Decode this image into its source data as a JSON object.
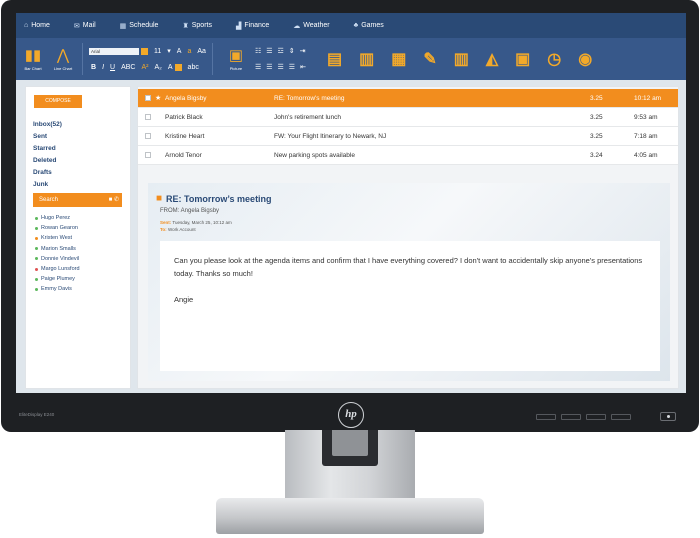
{
  "bezel": {
    "model": "EliteDisplay E240",
    "brand": "hp"
  },
  "nav": {
    "items": [
      {
        "label": "Home",
        "icon": "home-icon",
        "glyph": "⌂"
      },
      {
        "label": "Mail",
        "icon": "mail-icon",
        "glyph": "✉"
      },
      {
        "label": "Schedule",
        "icon": "calendar-icon",
        "glyph": "▦"
      },
      {
        "label": "Sports",
        "icon": "trophy-icon",
        "glyph": "♜"
      },
      {
        "label": "Finance",
        "icon": "finance-icon",
        "glyph": "▟"
      },
      {
        "label": "Weather",
        "icon": "cloud-icon",
        "glyph": "☁"
      },
      {
        "label": "Games",
        "icon": "games-icon",
        "glyph": "♣"
      }
    ]
  },
  "ribbon": {
    "bar_chart_label": "Bar Chart",
    "line_chart_label": "Line Chart",
    "font_name": "Arial",
    "font_size": "11",
    "picture_label": "Picture",
    "accent_color": "#f2a92a"
  },
  "sidebar": {
    "compose_label": "COMPOSE",
    "folders": [
      "Inbox(52)",
      "Sent",
      "Starred",
      "Deleted",
      "Drafts",
      "Junk"
    ],
    "search_label": "Search",
    "contacts": [
      {
        "name": "Hugo Perez",
        "status": "#5cb85c"
      },
      {
        "name": "Rowan Gearon",
        "status": "#5cb85c"
      },
      {
        "name": "Kristen West",
        "status": "#f28d1e"
      },
      {
        "name": "Marion Smalls",
        "status": "#5cb85c"
      },
      {
        "name": "Donnie Vindevil",
        "status": "#5cb85c"
      },
      {
        "name": "Margo Lunsford",
        "status": "#e05252"
      },
      {
        "name": "Paige Plumey",
        "status": "#5cb85c"
      },
      {
        "name": "Emmy Davis",
        "status": "#5cb85c"
      }
    ]
  },
  "messages": [
    {
      "from": "Angela Bigsby",
      "subject": "RE: Tomorrow's meeting",
      "size": "3.25",
      "time": "10:12 am",
      "selected": true
    },
    {
      "from": "Patrick Black",
      "subject": "John's retirement lunch",
      "size": "3.25",
      "time": "9:53 am",
      "selected": false
    },
    {
      "from": "Kristine Heart",
      "subject": "FW: Your Flight Itinerary to Newark, NJ",
      "size": "3.25",
      "time": "7:18 am",
      "selected": false
    },
    {
      "from": "Arnold Tenor",
      "subject": "New parking spots available",
      "size": "3.24",
      "time": "4:05 am",
      "selected": false
    }
  ],
  "reading": {
    "subject": "RE: Tomorrow’s meeting",
    "from": "FROM: Angela Bigsby",
    "sent_label": "Sent:",
    "sent_value": "Tuesday, March 25, 10:12 am",
    "to_label": "To:",
    "to_value": "Work Account",
    "body": "Can you please look at the agenda items and confirm that I have everything covered? I don't want to accidentally skip anyone's presentations today. Thanks so much!",
    "signature": "Angie"
  },
  "colors": {
    "nav": "#2a4a76",
    "ribbon": "#37588a",
    "accent": "#f28d1e"
  }
}
